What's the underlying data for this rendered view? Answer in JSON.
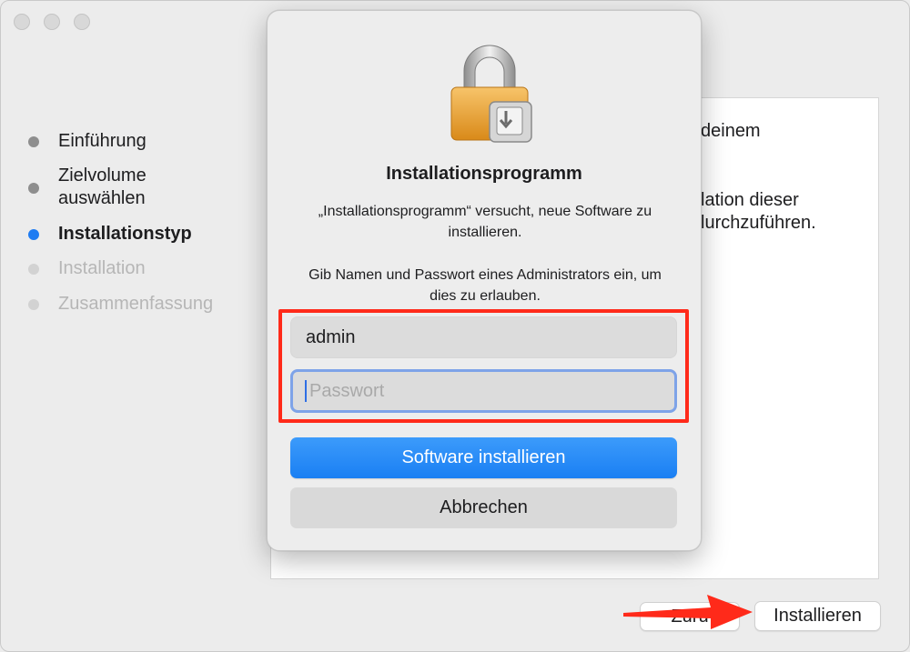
{
  "steps": [
    {
      "label": "Einführung",
      "state": "done"
    },
    {
      "label": "Zielvolume auswählen",
      "state": "done"
    },
    {
      "label": "Installationstyp",
      "state": "active"
    },
    {
      "label": "Installation",
      "state": "pending"
    },
    {
      "label": "Zusammenfassung",
      "state": "pending"
    }
  ],
  "pane": {
    "line1": "deinem",
    "line2": "lation dieser",
    "line3": "lurchzuführen."
  },
  "buttons": {
    "back_label": "Zurü",
    "install_label": "Installieren"
  },
  "dialog": {
    "title": "Installationsprogramm",
    "message": "„Installationsprogramm“ versucht, neue Software zu installieren.",
    "prompt": "Gib Namen und Passwort eines Administrators ein, um dies zu erlauben.",
    "username_value": "admin",
    "password_placeholder": "Passwort",
    "confirm_label": "Software installieren",
    "cancel_label": "Abbrechen"
  },
  "colors": {
    "accent": "#1f7cf2",
    "highlight": "#ff2a1a",
    "primary_button": "#1a7ff3"
  },
  "icons": {
    "dialog_icon": "lock-icon",
    "annotation": "red-arrow-icon"
  }
}
